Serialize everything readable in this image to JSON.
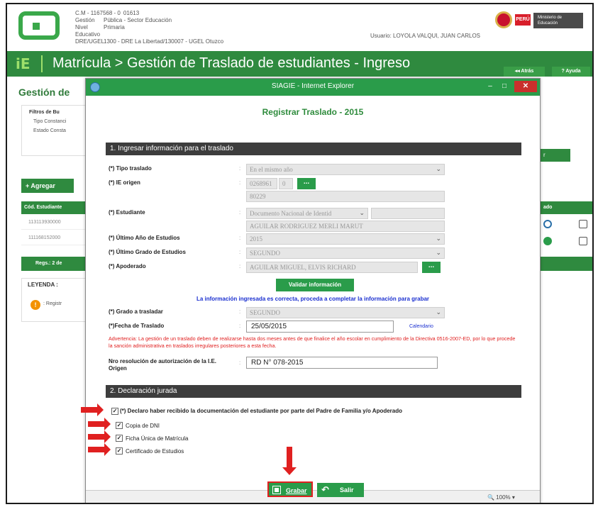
{
  "header": {
    "info_rows": [
      {
        "k": "C.M - 1167568 - 0",
        "v": "01613"
      },
      {
        "k": "Gestión",
        "v": "Pública - Sector Educación"
      },
      {
        "k": "Nivel Educativo",
        "v": "Primaria"
      },
      {
        "k": "DRE/UGEL",
        "v": "1300 - DRE La Libertad/130007 - UGEL Otuzco"
      }
    ],
    "usuario": "Usuario: LOYOLA VALQUI, JUAN CARLOS",
    "peru_label": "PERÚ",
    "ministerio": "Ministerio de Educación"
  },
  "title_bar": {
    "logo": "iE",
    "title": "Matrícula > Gestión de Traslado de estudiantes - Ingreso",
    "atras": "◂◂ Atrás",
    "ayuda": "? Ayuda"
  },
  "background": {
    "heading": "Gestión de",
    "filtros": "Filtros de Bu",
    "tipo": "Tipo Constanci",
    "estado": "Estado Consta",
    "agregar": "+ Agregar",
    "col_estudiante": "Cód. Estudiante",
    "rows": [
      "113113930000",
      "111168152000"
    ],
    "regs": "Regs.: 2 de",
    "leyenda": "LEYENDA :",
    "leyenda_icon": "!",
    "leyenda_item": ": Registr",
    "right_btn": "r",
    "right_col": "ado"
  },
  "modal": {
    "window_title": "SIAGIE - Internet Explorer",
    "win_min": "–",
    "win_max": "□",
    "win_close": "✕",
    "form_title": "Registrar Traslado - 2015",
    "section1": "1. Ingresar información para el traslado",
    "fields": {
      "tipo_traslado": {
        "label": "(*) Tipo traslado",
        "value": "En el mismo año"
      },
      "ie_origen": {
        "label": "(*) IE origen",
        "code": "0268961",
        "anexo": "0",
        "name": "80229",
        "btn": "..."
      },
      "estudiante": {
        "label": "(*) Estudiante",
        "doc_type": "Documento Nacional de Identid",
        "name": "AGUILAR RODRIGUEZ MERLI MARUT"
      },
      "ultimo_anio": {
        "label": "(*) Último Año de Estudios",
        "value": "2015"
      },
      "ultimo_grado": {
        "label": "(*) Último Grado de Estudios",
        "value": "SEGUNDO"
      },
      "apoderado": {
        "label": "(*) Apoderado",
        "value": "AGUILAR MIGUEL, ELVIS RICHARD",
        "btn": "..."
      },
      "grado_trasladar": {
        "label": "(*) Grado a trasladar",
        "value": "SEGUNDO"
      },
      "fecha_traslado": {
        "label": "(*)Fecha de Traslado",
        "value": "25/05/2015",
        "calendario": "Calendario"
      },
      "nro_resolucion": {
        "label": "Nro resolución de autorización de la I.E. Origen",
        "value": "RD N° 078-2015"
      }
    },
    "colon": ":",
    "validar": "Validar información",
    "info_msg": "La información ingresada es correcta, proceda a completar la información para grabar",
    "warning": "Advertencia: La gestión de un traslado deben de realizarse hasta dos meses antes de que finalice el año escolar en cumplimiento de la Directiva 0516-2007-ED, por lo que procede la sanción administrativa en traslados irregulares posteriores a esta fecha.",
    "section2": "2. Declaración jurada",
    "checks": [
      {
        "label": "(*) Declaro haber recibido la documentación del estudiante por parte del Padre de Familia y/o Apoderado",
        "checked": true
      },
      {
        "label": "Copia de DNI",
        "checked": true
      },
      {
        "label": "Ficha Única de Matrícula",
        "checked": true
      },
      {
        "label": "Certificado de Estudios",
        "checked": true
      }
    ],
    "check_mark": "✓",
    "grabar": "Grabar",
    "salir": "Salir",
    "salir_icon": "↶",
    "chevron": "⌄",
    "zoom": "🔍 100%  ▾"
  },
  "colors": {
    "green": "#2a9c4a",
    "title_bar": "#2f8a3f",
    "section": "#3d3d3d",
    "warning": "#e02020",
    "info": "#1a2fd0"
  }
}
